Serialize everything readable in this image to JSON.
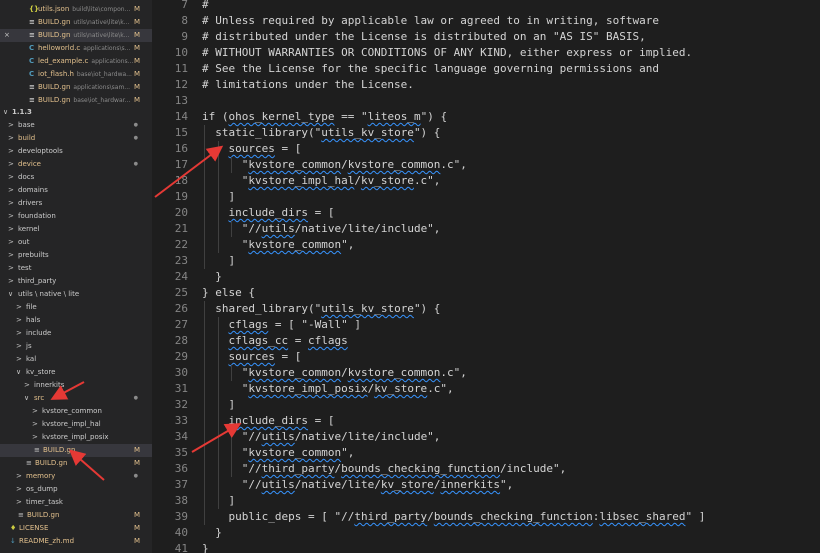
{
  "sidebar": {
    "open_editors": [
      {
        "icon": "{}",
        "icon_color": "#cbcb41",
        "name": "utils.json",
        "desc": "build\\lite\\compon...",
        "status": "M"
      },
      {
        "icon": "≡",
        "icon_color": "#cccccc",
        "name": "BUILD.gn",
        "desc": "utils\\native\\lite\\k...",
        "status": "M"
      },
      {
        "icon": "≡",
        "icon_color": "#cccccc",
        "name": "BUILD.gn",
        "desc": "utils\\native\\lite\\k...",
        "status": "M",
        "selected": true,
        "close": "×"
      },
      {
        "icon": "C",
        "icon_color": "#519aba",
        "name": "helloworld.c",
        "desc": "applications\\s...",
        "status": "M"
      },
      {
        "icon": "C",
        "icon_color": "#519aba",
        "name": "led_example.c",
        "desc": "applications...",
        "status": "M"
      },
      {
        "icon": "C",
        "icon_color": "#519aba",
        "name": "iot_flash.h",
        "desc": "base\\iot_hardwa...",
        "status": "M"
      },
      {
        "icon": "≡",
        "icon_color": "#cccccc",
        "name": "BUILD.gn",
        "desc": "applications\\sam...",
        "status": "M"
      },
      {
        "icon": "≡",
        "icon_color": "#cccccc",
        "name": "BUILD.gn",
        "desc": "base\\iot_hardwar...",
        "status": "M"
      }
    ],
    "root_label": "1.1.3",
    "tree": [
      {
        "name": "base",
        "depth": 0,
        "chev": ">",
        "dot": true,
        "color": "#cccccc"
      },
      {
        "name": "build",
        "depth": 0,
        "chev": ">",
        "dot": true,
        "color": "#e2c08d"
      },
      {
        "name": "developtools",
        "depth": 0,
        "chev": ">",
        "color": "#cccccc"
      },
      {
        "name": "device",
        "depth": 0,
        "chev": ">",
        "dot": true,
        "color": "#e2c08d"
      },
      {
        "name": "docs",
        "depth": 0,
        "chev": ">",
        "color": "#cccccc"
      },
      {
        "name": "domains",
        "depth": 0,
        "chev": ">",
        "color": "#cccccc"
      },
      {
        "name": "drivers",
        "depth": 0,
        "chev": ">",
        "color": "#cccccc"
      },
      {
        "name": "foundation",
        "depth": 0,
        "chev": ">",
        "color": "#cccccc"
      },
      {
        "name": "kernel",
        "depth": 0,
        "chev": ">",
        "color": "#cccccc"
      },
      {
        "name": "out",
        "depth": 0,
        "chev": ">",
        "color": "#cccccc"
      },
      {
        "name": "prebuilts",
        "depth": 0,
        "chev": ">",
        "color": "#cccccc"
      },
      {
        "name": "test",
        "depth": 0,
        "chev": ">",
        "color": "#cccccc"
      },
      {
        "name": "third_party",
        "depth": 0,
        "chev": ">",
        "color": "#cccccc"
      },
      {
        "name": "utils \\ native \\ lite",
        "depth": 0,
        "chev": "∨",
        "color": "#cccccc"
      },
      {
        "name": "file",
        "depth": 1,
        "chev": ">",
        "color": "#cccccc"
      },
      {
        "name": "hals",
        "depth": 1,
        "chev": ">",
        "color": "#cccccc"
      },
      {
        "name": "include",
        "depth": 1,
        "chev": ">",
        "color": "#cccccc"
      },
      {
        "name": "js",
        "depth": 1,
        "chev": ">",
        "color": "#cccccc"
      },
      {
        "name": "kal",
        "depth": 1,
        "chev": ">",
        "color": "#cccccc"
      },
      {
        "name": "kv_store",
        "depth": 1,
        "chev": "∨",
        "color": "#cccccc"
      },
      {
        "name": "innerkits",
        "depth": 2,
        "chev": ">",
        "color": "#cccccc"
      },
      {
        "name": "src",
        "depth": 2,
        "chev": "∨",
        "dot": true,
        "color": "#e2c08d"
      },
      {
        "name": "kvstore_common",
        "depth": 3,
        "chev": ">",
        "color": "#cccccc"
      },
      {
        "name": "kvstore_impl_hal",
        "depth": 3,
        "chev": ">",
        "color": "#cccccc"
      },
      {
        "name": "kvstore_impl_posix",
        "depth": 3,
        "chev": ">",
        "color": "#cccccc"
      },
      {
        "name": "BUILD.gn",
        "depth": 3,
        "file": true,
        "status": "M",
        "selected": true,
        "color": "#e2c08d"
      },
      {
        "name": "BUILD.gn",
        "depth": 2,
        "file": true,
        "status": "M",
        "color": "#e2c08d"
      },
      {
        "name": "memory",
        "depth": 1,
        "chev": ">",
        "dot": true,
        "color": "#e2c08d"
      },
      {
        "name": "os_dump",
        "depth": 1,
        "chev": ">",
        "color": "#cccccc"
      },
      {
        "name": "timer_task",
        "depth": 1,
        "chev": ">",
        "color": "#cccccc"
      },
      {
        "name": "BUILD.gn",
        "depth": 1,
        "file": true,
        "status": "M",
        "color": "#e2c08d"
      },
      {
        "name": "LICENSE",
        "depth": 0,
        "file": true,
        "license": true,
        "status": "M",
        "color": "#e2c08d"
      },
      {
        "name": "README_zh.md",
        "depth": 0,
        "file": true,
        "md": true,
        "status": "M",
        "color": "#e2c08d"
      }
    ]
  },
  "editor": {
    "lines": [
      {
        "n": "7",
        "t": "#"
      },
      {
        "n": "8",
        "t": "# Unless required by applicable law or agreed to in writing, software"
      },
      {
        "n": "9",
        "t": "# distributed under the License is distributed on an \"AS IS\" BASIS,"
      },
      {
        "n": "10",
        "t": "# WITHOUT WARRANTIES OR CONDITIONS OF ANY KIND, either express or implied."
      },
      {
        "n": "11",
        "t": "# See the License for the specific language governing permissions and"
      },
      {
        "n": "12",
        "t": "# limitations under the License."
      },
      {
        "n": "13",
        "t": ""
      },
      {
        "n": "14",
        "t": "if (ohos_kernel_type == \"liteos_m\") {"
      },
      {
        "n": "15",
        "t": "  static_library(\"utils_kv_store\") {"
      },
      {
        "n": "16",
        "t": "    sources = ["
      },
      {
        "n": "17",
        "t": "      \"kvstore_common/kvstore_common.c\","
      },
      {
        "n": "18",
        "t": "      \"kvstore_impl_hal/kv_store.c\","
      },
      {
        "n": "19",
        "t": "    ]"
      },
      {
        "n": "20",
        "t": "    include_dirs = ["
      },
      {
        "n": "21",
        "t": "      \"//utils/native/lite/include\","
      },
      {
        "n": "22",
        "t": "      \"kvstore_common\","
      },
      {
        "n": "23",
        "t": "    ]"
      },
      {
        "n": "24",
        "t": "  }"
      },
      {
        "n": "25",
        "t": "} else {"
      },
      {
        "n": "26",
        "t": "  shared_library(\"utils_kv_store\") {"
      },
      {
        "n": "27",
        "t": "    cflags = [ \"-Wall\" ]"
      },
      {
        "n": "28",
        "t": "    cflags_cc = cflags"
      },
      {
        "n": "29",
        "t": "    sources = ["
      },
      {
        "n": "30",
        "t": "      \"kvstore_common/kvstore_common.c\","
      },
      {
        "n": "31",
        "t": "      \"kvstore_impl_posix/kv_store.c\","
      },
      {
        "n": "32",
        "t": "    ]"
      },
      {
        "n": "33",
        "t": "    include_dirs = ["
      },
      {
        "n": "34",
        "t": "      \"//utils/native/lite/include\","
      },
      {
        "n": "35",
        "t": "      \"kvstore_common\","
      },
      {
        "n": "36",
        "t": "      \"//third_party/bounds_checking_function/include\","
      },
      {
        "n": "37",
        "t": "      \"//utils/native/lite/kv_store/innerkits\","
      },
      {
        "n": "38",
        "t": "    ]"
      },
      {
        "n": "39",
        "t": "    public_deps = [ \"//third_party/bounds_checking_function:libsec_shared\" ]"
      },
      {
        "n": "40",
        "t": "  }"
      },
      {
        "n": "41",
        "t": "}"
      }
    ]
  },
  "colors": {
    "arrow": "#e53935",
    "modified": "#e2c08d",
    "sidebar_bg": "#252526",
    "editor_bg": "#1e1e1e"
  }
}
